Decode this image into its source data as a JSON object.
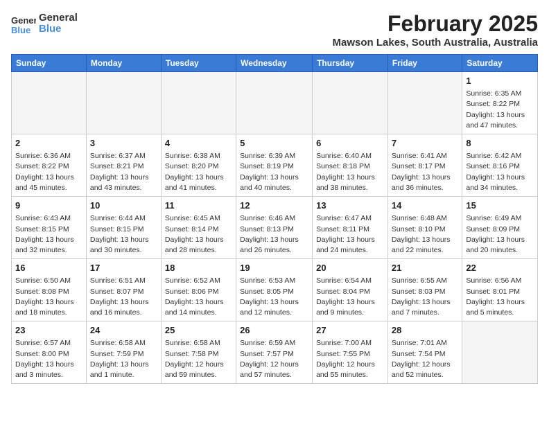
{
  "logo": {
    "general": "General",
    "blue": "Blue"
  },
  "header": {
    "title": "February 2025",
    "subtitle": "Mawson Lakes, South Australia, Australia"
  },
  "weekdays": [
    "Sunday",
    "Monday",
    "Tuesday",
    "Wednesday",
    "Thursday",
    "Friday",
    "Saturday"
  ],
  "weeks": [
    [
      {
        "num": "",
        "info": "",
        "empty": true
      },
      {
        "num": "",
        "info": "",
        "empty": true
      },
      {
        "num": "",
        "info": "",
        "empty": true
      },
      {
        "num": "",
        "info": "",
        "empty": true
      },
      {
        "num": "",
        "info": "",
        "empty": true
      },
      {
        "num": "",
        "info": "",
        "empty": true
      },
      {
        "num": "1",
        "info": "Sunrise: 6:35 AM\nSunset: 8:22 PM\nDaylight: 13 hours and 47 minutes.",
        "empty": false
      }
    ],
    [
      {
        "num": "2",
        "info": "Sunrise: 6:36 AM\nSunset: 8:22 PM\nDaylight: 13 hours and 45 minutes.",
        "empty": false
      },
      {
        "num": "3",
        "info": "Sunrise: 6:37 AM\nSunset: 8:21 PM\nDaylight: 13 hours and 43 minutes.",
        "empty": false
      },
      {
        "num": "4",
        "info": "Sunrise: 6:38 AM\nSunset: 8:20 PM\nDaylight: 13 hours and 41 minutes.",
        "empty": false
      },
      {
        "num": "5",
        "info": "Sunrise: 6:39 AM\nSunset: 8:19 PM\nDaylight: 13 hours and 40 minutes.",
        "empty": false
      },
      {
        "num": "6",
        "info": "Sunrise: 6:40 AM\nSunset: 8:18 PM\nDaylight: 13 hours and 38 minutes.",
        "empty": false
      },
      {
        "num": "7",
        "info": "Sunrise: 6:41 AM\nSunset: 8:17 PM\nDaylight: 13 hours and 36 minutes.",
        "empty": false
      },
      {
        "num": "8",
        "info": "Sunrise: 6:42 AM\nSunset: 8:16 PM\nDaylight: 13 hours and 34 minutes.",
        "empty": false
      }
    ],
    [
      {
        "num": "9",
        "info": "Sunrise: 6:43 AM\nSunset: 8:15 PM\nDaylight: 13 hours and 32 minutes.",
        "empty": false
      },
      {
        "num": "10",
        "info": "Sunrise: 6:44 AM\nSunset: 8:15 PM\nDaylight: 13 hours and 30 minutes.",
        "empty": false
      },
      {
        "num": "11",
        "info": "Sunrise: 6:45 AM\nSunset: 8:14 PM\nDaylight: 13 hours and 28 minutes.",
        "empty": false
      },
      {
        "num": "12",
        "info": "Sunrise: 6:46 AM\nSunset: 8:13 PM\nDaylight: 13 hours and 26 minutes.",
        "empty": false
      },
      {
        "num": "13",
        "info": "Sunrise: 6:47 AM\nSunset: 8:11 PM\nDaylight: 13 hours and 24 minutes.",
        "empty": false
      },
      {
        "num": "14",
        "info": "Sunrise: 6:48 AM\nSunset: 8:10 PM\nDaylight: 13 hours and 22 minutes.",
        "empty": false
      },
      {
        "num": "15",
        "info": "Sunrise: 6:49 AM\nSunset: 8:09 PM\nDaylight: 13 hours and 20 minutes.",
        "empty": false
      }
    ],
    [
      {
        "num": "16",
        "info": "Sunrise: 6:50 AM\nSunset: 8:08 PM\nDaylight: 13 hours and 18 minutes.",
        "empty": false
      },
      {
        "num": "17",
        "info": "Sunrise: 6:51 AM\nSunset: 8:07 PM\nDaylight: 13 hours and 16 minutes.",
        "empty": false
      },
      {
        "num": "18",
        "info": "Sunrise: 6:52 AM\nSunset: 8:06 PM\nDaylight: 13 hours and 14 minutes.",
        "empty": false
      },
      {
        "num": "19",
        "info": "Sunrise: 6:53 AM\nSunset: 8:05 PM\nDaylight: 13 hours and 12 minutes.",
        "empty": false
      },
      {
        "num": "20",
        "info": "Sunrise: 6:54 AM\nSunset: 8:04 PM\nDaylight: 13 hours and 9 minutes.",
        "empty": false
      },
      {
        "num": "21",
        "info": "Sunrise: 6:55 AM\nSunset: 8:03 PM\nDaylight: 13 hours and 7 minutes.",
        "empty": false
      },
      {
        "num": "22",
        "info": "Sunrise: 6:56 AM\nSunset: 8:01 PM\nDaylight: 13 hours and 5 minutes.",
        "empty": false
      }
    ],
    [
      {
        "num": "23",
        "info": "Sunrise: 6:57 AM\nSunset: 8:00 PM\nDaylight: 13 hours and 3 minutes.",
        "empty": false
      },
      {
        "num": "24",
        "info": "Sunrise: 6:58 AM\nSunset: 7:59 PM\nDaylight: 13 hours and 1 minute.",
        "empty": false
      },
      {
        "num": "25",
        "info": "Sunrise: 6:58 AM\nSunset: 7:58 PM\nDaylight: 12 hours and 59 minutes.",
        "empty": false
      },
      {
        "num": "26",
        "info": "Sunrise: 6:59 AM\nSunset: 7:57 PM\nDaylight: 12 hours and 57 minutes.",
        "empty": false
      },
      {
        "num": "27",
        "info": "Sunrise: 7:00 AM\nSunset: 7:55 PM\nDaylight: 12 hours and 55 minutes.",
        "empty": false
      },
      {
        "num": "28",
        "info": "Sunrise: 7:01 AM\nSunset: 7:54 PM\nDaylight: 12 hours and 52 minutes.",
        "empty": false
      },
      {
        "num": "",
        "info": "",
        "empty": true
      }
    ]
  ]
}
